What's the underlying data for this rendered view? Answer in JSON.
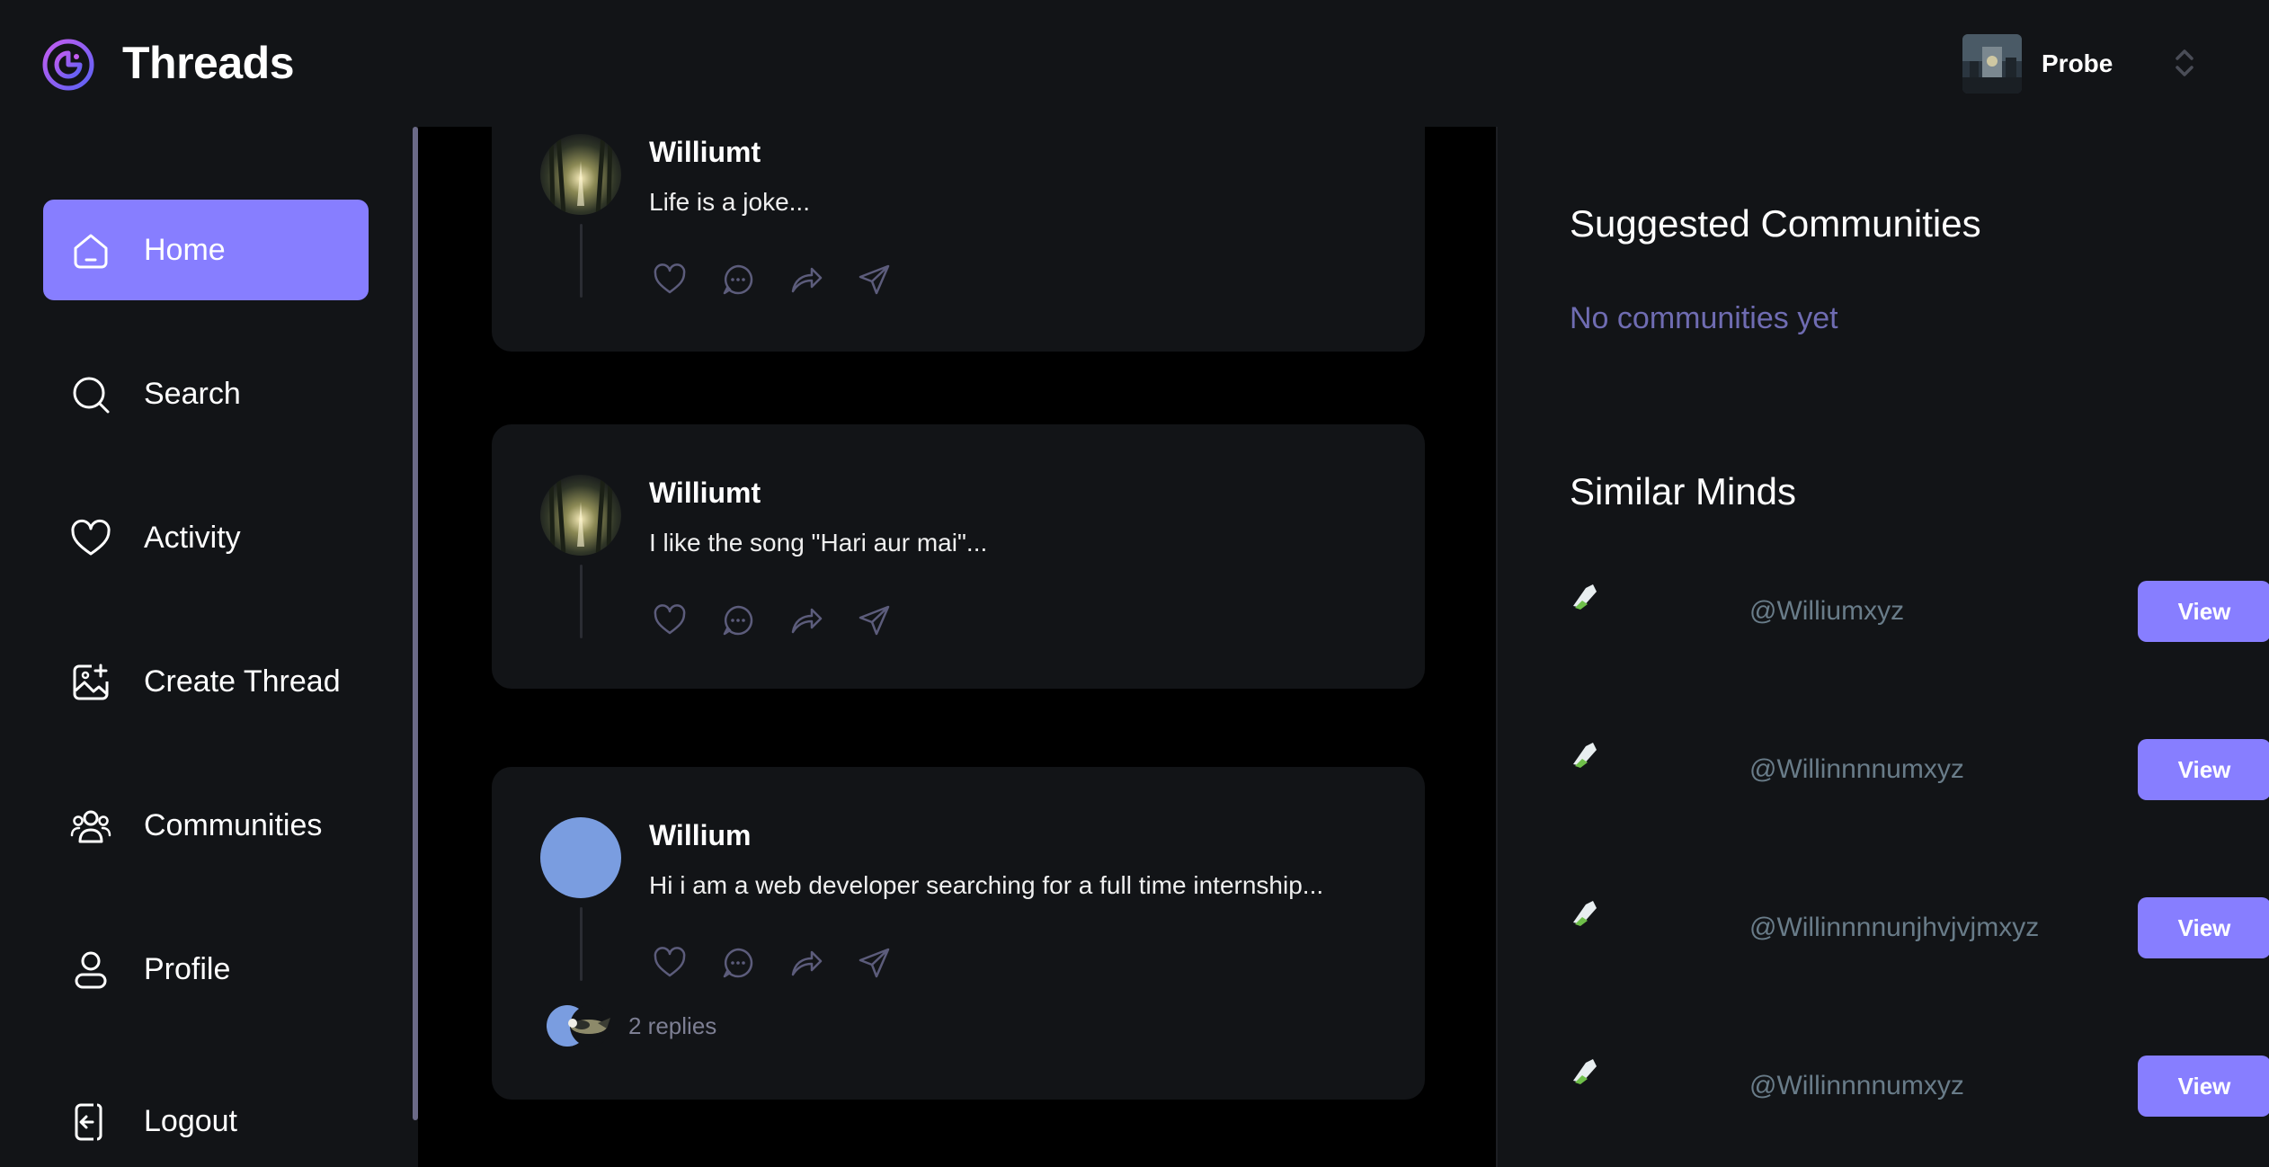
{
  "app": {
    "title": "Threads"
  },
  "topbar": {
    "user_name": "Probe"
  },
  "sidebar": {
    "items": [
      {
        "label": "Home",
        "icon": "home-icon",
        "active": true
      },
      {
        "label": "Search",
        "icon": "search-icon"
      },
      {
        "label": "Activity",
        "icon": "heart-icon"
      },
      {
        "label": "Create Thread",
        "icon": "create-thread-icon"
      },
      {
        "label": "Communities",
        "icon": "communities-icon"
      },
      {
        "label": "Profile",
        "icon": "user-icon"
      }
    ],
    "logout_label": "Logout"
  },
  "feed": {
    "threads": [
      {
        "author": "Williumt",
        "text": "Life is a joke..."
      },
      {
        "author": "Williumt",
        "text": "I like the song \"Hari aur mai\"..."
      },
      {
        "author": "Willium",
        "text": "Hi i am a web developer searching for a full time internship...",
        "replies": "2 replies"
      }
    ]
  },
  "right": {
    "communities_title": "Suggested Communities",
    "communities_empty": "No communities yet",
    "similar_title": "Similar Minds",
    "users": [
      {
        "handle": "@Williumxyz",
        "button": "View"
      },
      {
        "handle": "@Willinnnnumxyz",
        "button": "View"
      },
      {
        "handle": "@Willinnnnunjhvjvjmxyz",
        "button": "View"
      },
      {
        "handle": "@Willinnnnumxyz",
        "button": "View"
      }
    ]
  },
  "colors": {
    "accent": "#877EFF",
    "background": "#121417",
    "feed_background": "#000000",
    "muted_text": "#697C89"
  }
}
